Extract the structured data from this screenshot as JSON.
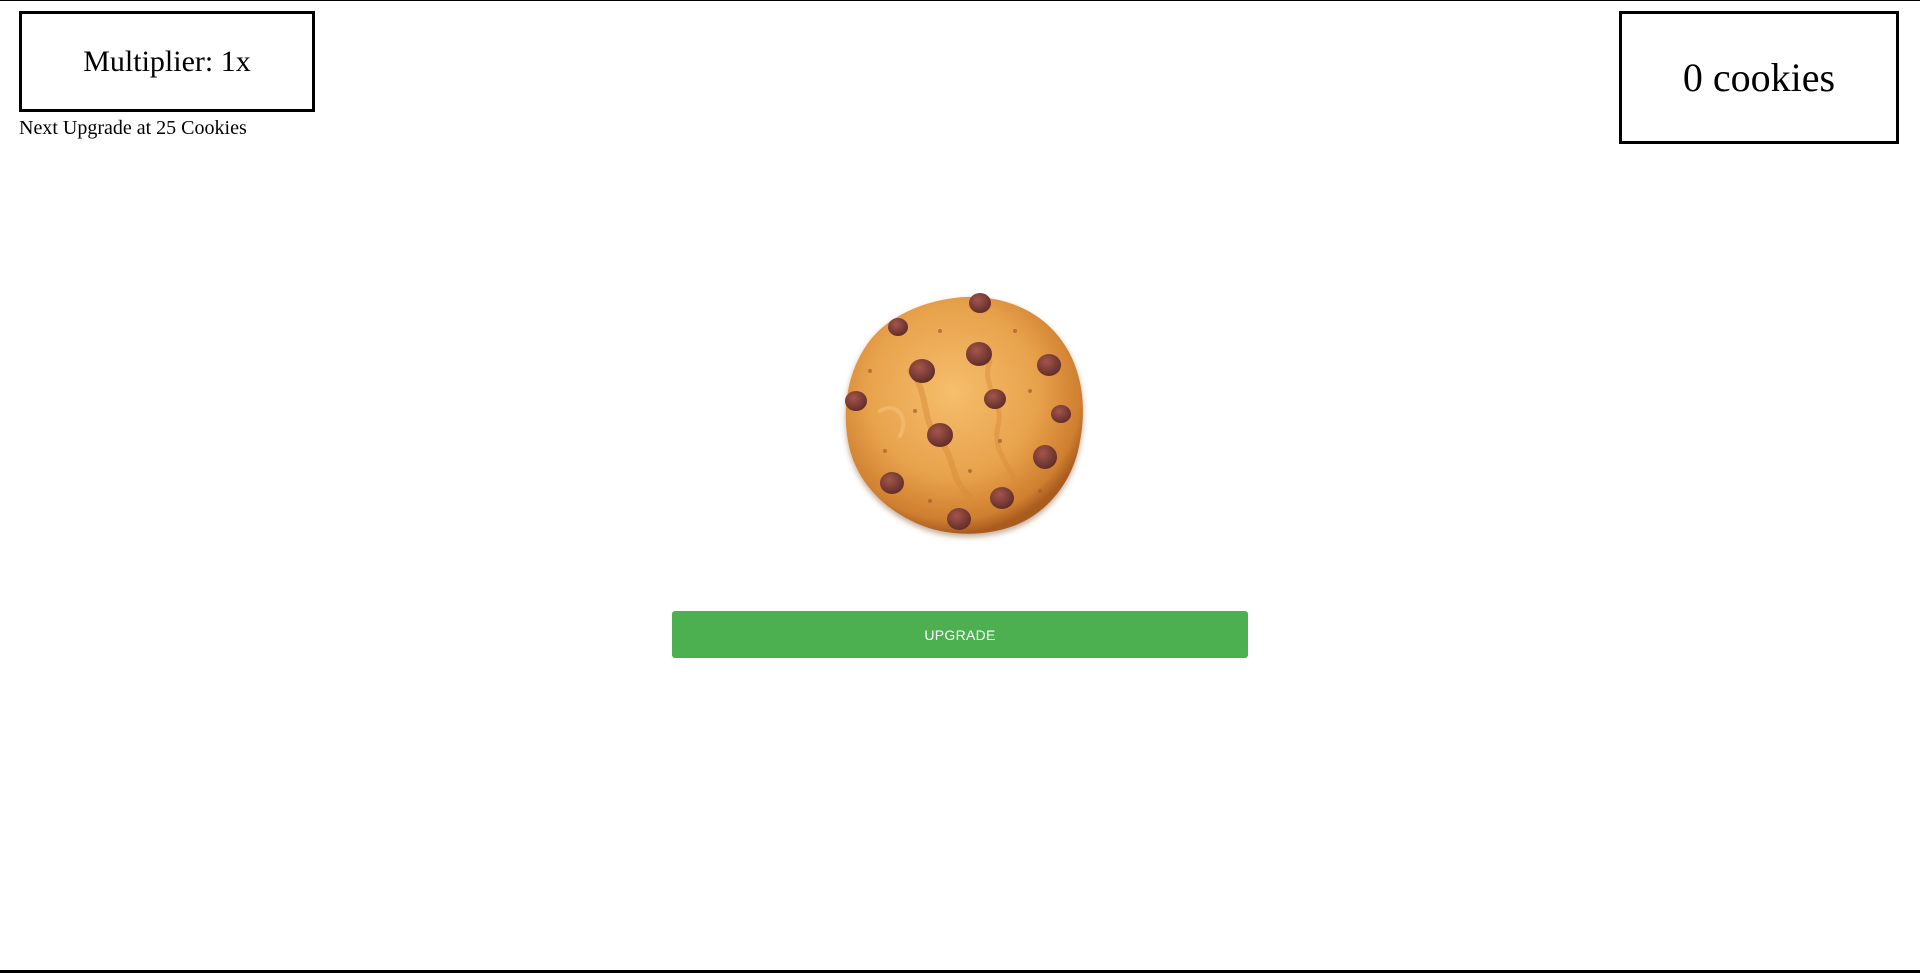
{
  "stats": {
    "multiplier_text": "Multiplier: 1x",
    "next_upgrade_text": "Next Upgrade at 25 Cookies",
    "cookie_count_text": "0 cookies"
  },
  "controls": {
    "upgrade_label": "UPGRADE"
  },
  "cookie": {
    "icon": "cookie-icon"
  },
  "colors": {
    "upgrade_button": "#4caf50",
    "cookie_dough": "#e6a04a",
    "chocolate_chip": "#7a3a32"
  }
}
